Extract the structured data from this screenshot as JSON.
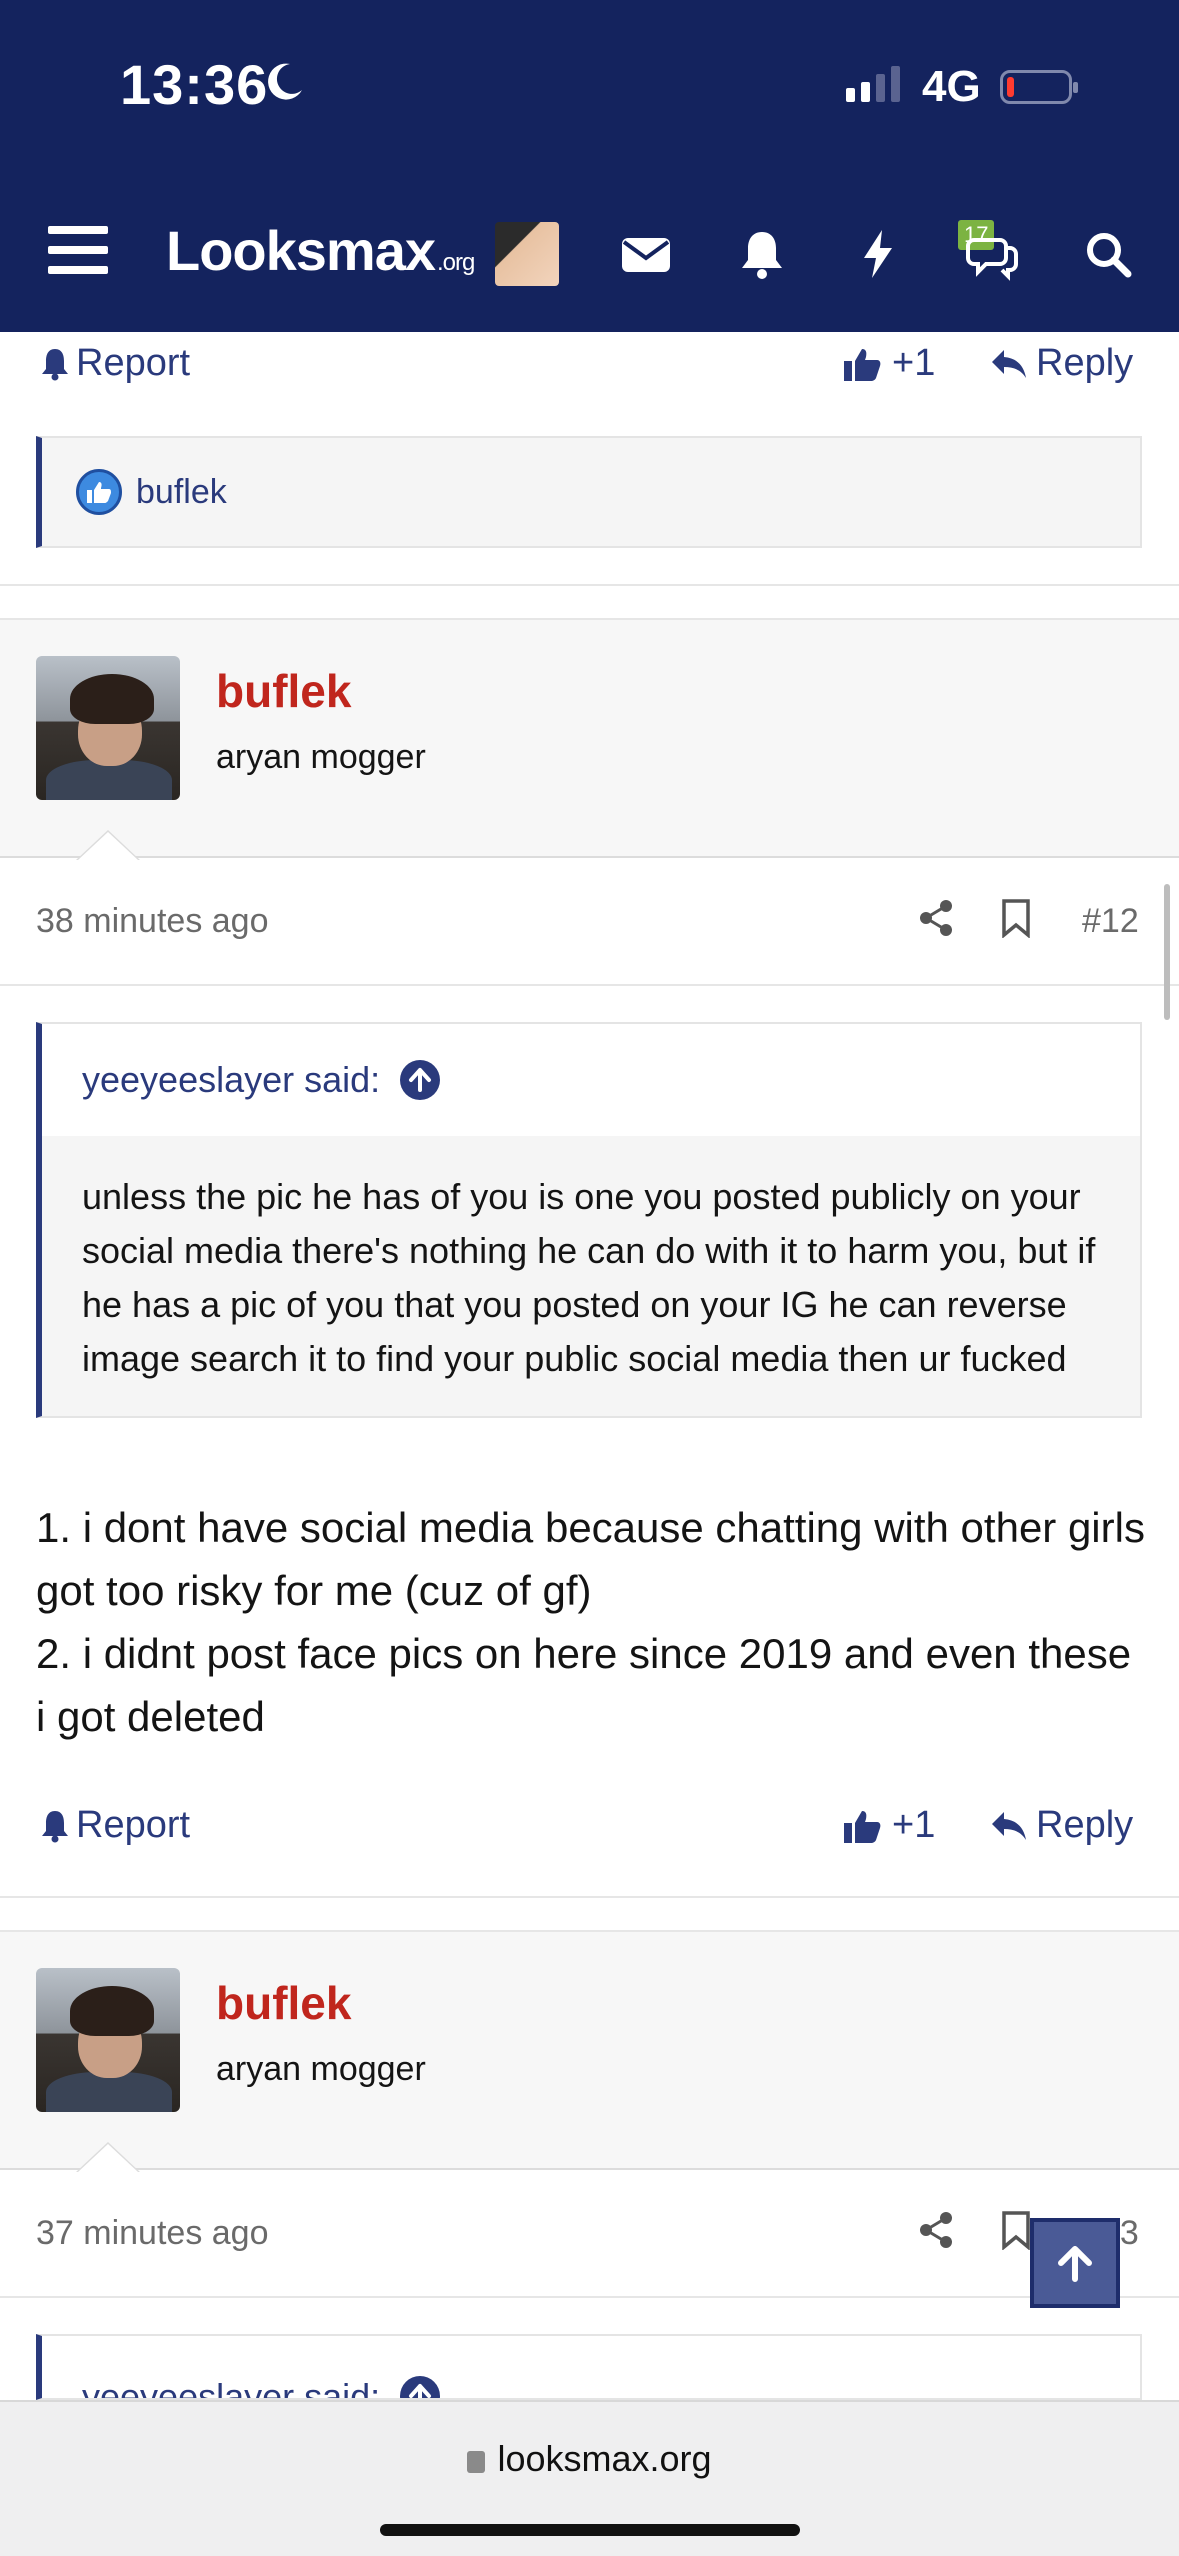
{
  "status_bar": {
    "time": "13:36",
    "network": "4G"
  },
  "header": {
    "logo_main": "Looksmax",
    "logo_suffix": ".org",
    "badge_count": "17"
  },
  "top_actions": {
    "report": "Report",
    "like_count": "+1",
    "reply": "Reply"
  },
  "reactions": {
    "user": "buflek"
  },
  "post1": {
    "username": "buflek",
    "user_title": "aryan mogger",
    "time": "38 minutes ago",
    "post_number": "#12",
    "quote_author": "yeeyeeslayer said:",
    "quote_text": "unless the pic he has of you is one you posted publicly on your social media there's nothing he can do with it to harm you, but if he has a pic of you that you posted on your IG he can reverse image search it to find your public social media then ur fucked",
    "body_line1": "1. i dont have social media because chatting with other girls got too risky for me (cuz of gf)",
    "body_line2": "2. i didnt post face pics on here since 2019 and even these i got deleted",
    "report": "Report",
    "like_count": "+1",
    "reply": "Reply"
  },
  "post2": {
    "username": "buflek",
    "user_title": "aryan mogger",
    "time": "37 minutes ago",
    "post_number": "#13",
    "quote_author": "yeeyeeslayer said:"
  },
  "browser": {
    "url": "looksmax.org"
  },
  "colors": {
    "header_bg": "#14235e",
    "link": "#2a3a7c",
    "username": "#c0261d",
    "badge": "#7cb342"
  }
}
